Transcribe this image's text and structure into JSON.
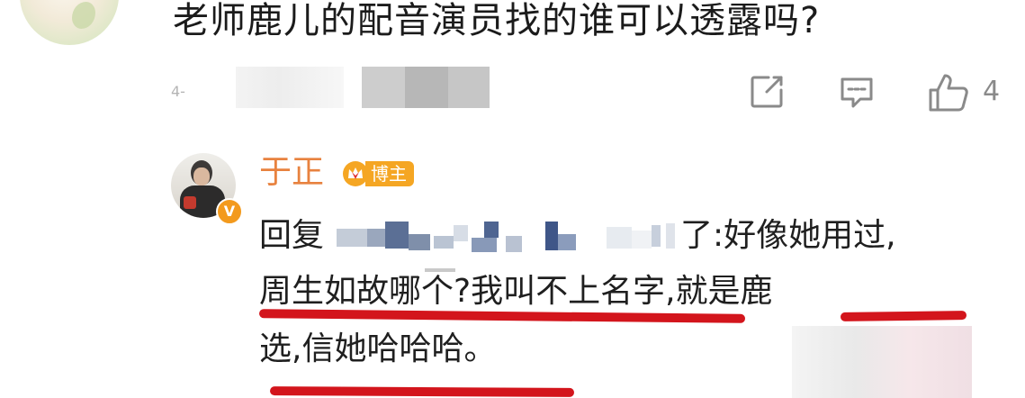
{
  "comment": {
    "question": "老师鹿儿的配音演员找的谁可以透露吗?",
    "time": "4-",
    "like_count": "4",
    "actions": {
      "share_icon": "share-icon",
      "comment_icon": "comment-icon",
      "like_icon": "thumbs-up-icon"
    }
  },
  "reply": {
    "username": "于正",
    "badge_label": "博主",
    "verified_mark": "V",
    "reply_prefix": "回复",
    "reply_mid": "了",
    "reply_tail": ":好像她用过,",
    "line2": "周生如故哪个?我叫不上名字,就是鹿",
    "line3": "选,信她哈哈哈。"
  },
  "colors": {
    "username": "#e8823f",
    "badge": "#f5a623",
    "underline": "#d3151c",
    "meta": "#8a8a8a"
  }
}
